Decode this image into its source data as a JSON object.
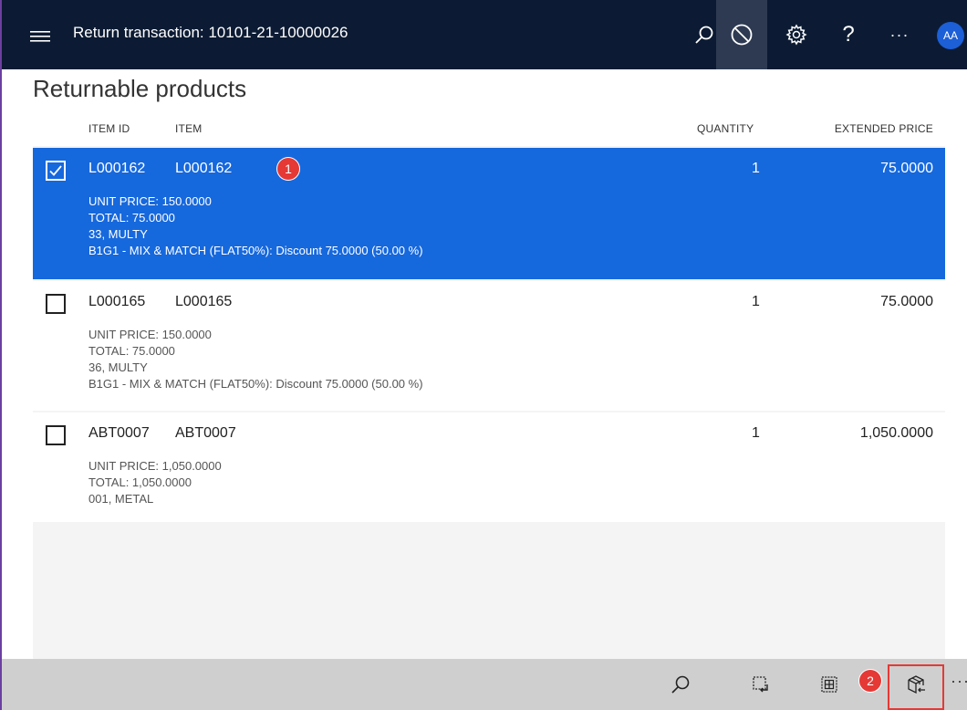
{
  "header": {
    "title": "Return transaction: 10101-21-10000026",
    "avatar_initials": "AA",
    "help_label": "?",
    "more_label": "···",
    "icons": [
      "menu-icon",
      "search-icon",
      "cancel-icon",
      "gear-icon",
      "help-icon",
      "more-icon"
    ]
  },
  "page": {
    "title": "Returnable products"
  },
  "columns": {
    "item_id": "ITEM ID",
    "item": "ITEM",
    "quantity": "QUANTITY",
    "extended_price": "EXTENDED PRICE"
  },
  "rows": [
    {
      "selected": true,
      "item_id": "L000162",
      "item": "L000162",
      "quantity": "1",
      "extended_price": "75.0000",
      "details": [
        "UNIT PRICE: 150.0000",
        "TOTAL: 75.0000",
        "33, MULTY",
        "B1G1 - MIX & MATCH (FLAT50%): Discount 75.0000 (50.00 %)"
      ]
    },
    {
      "selected": false,
      "item_id": "L000165",
      "item": "L000165",
      "quantity": "1",
      "extended_price": "75.0000",
      "details": [
        "UNIT PRICE: 150.0000",
        "TOTAL: 75.0000",
        "36, MULTY",
        "B1G1 - MIX & MATCH (FLAT50%): Discount 75.0000 (50.00 %)"
      ]
    },
    {
      "selected": false,
      "item_id": "ABT0007",
      "item": "ABT0007",
      "quantity": "1",
      "extended_price": "1,050.0000",
      "details": [
        "UNIT PRICE: 1,050.0000",
        "TOTAL: 1,050.0000",
        "001, METAL"
      ]
    }
  ],
  "callouts": {
    "one": "1",
    "two": "2"
  },
  "bottom_bar": {
    "icons": [
      "search-icon",
      "select-return-icon",
      "grid-icon",
      "return-products-icon"
    ],
    "more_label": "···"
  },
  "colors": {
    "topbar": "#0c1b33",
    "selected_row": "#1668dd",
    "callout": "#e53935",
    "bottombar": "#cfcfcf"
  }
}
